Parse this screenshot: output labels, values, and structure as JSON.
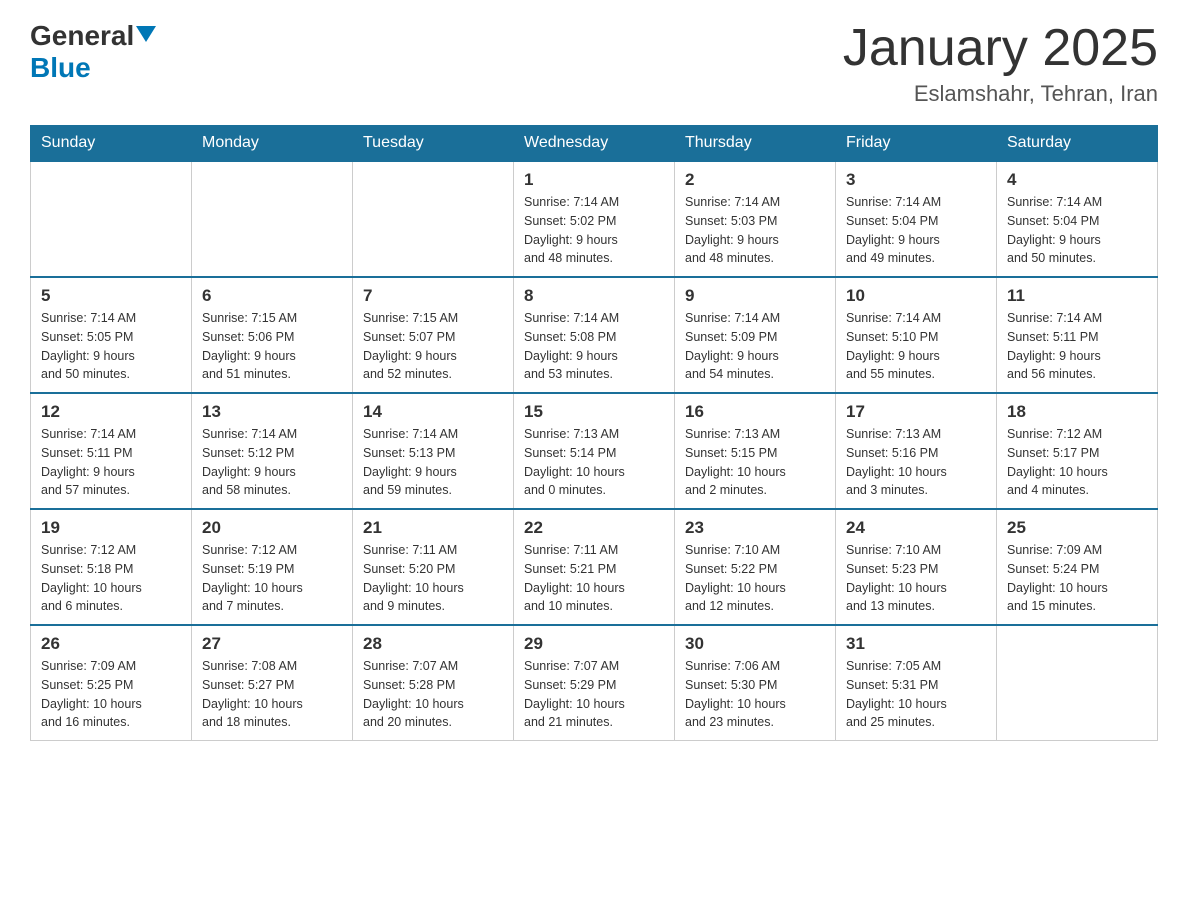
{
  "header": {
    "logo_general": "General",
    "logo_blue": "Blue",
    "month_title": "January 2025",
    "location": "Eslamshahr, Tehran, Iran"
  },
  "weekdays": [
    "Sunday",
    "Monday",
    "Tuesday",
    "Wednesday",
    "Thursday",
    "Friday",
    "Saturday"
  ],
  "weeks": [
    [
      {
        "day": "",
        "info": ""
      },
      {
        "day": "",
        "info": ""
      },
      {
        "day": "",
        "info": ""
      },
      {
        "day": "1",
        "info": "Sunrise: 7:14 AM\nSunset: 5:02 PM\nDaylight: 9 hours\nand 48 minutes."
      },
      {
        "day": "2",
        "info": "Sunrise: 7:14 AM\nSunset: 5:03 PM\nDaylight: 9 hours\nand 48 minutes."
      },
      {
        "day": "3",
        "info": "Sunrise: 7:14 AM\nSunset: 5:04 PM\nDaylight: 9 hours\nand 49 minutes."
      },
      {
        "day": "4",
        "info": "Sunrise: 7:14 AM\nSunset: 5:04 PM\nDaylight: 9 hours\nand 50 minutes."
      }
    ],
    [
      {
        "day": "5",
        "info": "Sunrise: 7:14 AM\nSunset: 5:05 PM\nDaylight: 9 hours\nand 50 minutes."
      },
      {
        "day": "6",
        "info": "Sunrise: 7:15 AM\nSunset: 5:06 PM\nDaylight: 9 hours\nand 51 minutes."
      },
      {
        "day": "7",
        "info": "Sunrise: 7:15 AM\nSunset: 5:07 PM\nDaylight: 9 hours\nand 52 minutes."
      },
      {
        "day": "8",
        "info": "Sunrise: 7:14 AM\nSunset: 5:08 PM\nDaylight: 9 hours\nand 53 minutes."
      },
      {
        "day": "9",
        "info": "Sunrise: 7:14 AM\nSunset: 5:09 PM\nDaylight: 9 hours\nand 54 minutes."
      },
      {
        "day": "10",
        "info": "Sunrise: 7:14 AM\nSunset: 5:10 PM\nDaylight: 9 hours\nand 55 minutes."
      },
      {
        "day": "11",
        "info": "Sunrise: 7:14 AM\nSunset: 5:11 PM\nDaylight: 9 hours\nand 56 minutes."
      }
    ],
    [
      {
        "day": "12",
        "info": "Sunrise: 7:14 AM\nSunset: 5:11 PM\nDaylight: 9 hours\nand 57 minutes."
      },
      {
        "day": "13",
        "info": "Sunrise: 7:14 AM\nSunset: 5:12 PM\nDaylight: 9 hours\nand 58 minutes."
      },
      {
        "day": "14",
        "info": "Sunrise: 7:14 AM\nSunset: 5:13 PM\nDaylight: 9 hours\nand 59 minutes."
      },
      {
        "day": "15",
        "info": "Sunrise: 7:13 AM\nSunset: 5:14 PM\nDaylight: 10 hours\nand 0 minutes."
      },
      {
        "day": "16",
        "info": "Sunrise: 7:13 AM\nSunset: 5:15 PM\nDaylight: 10 hours\nand 2 minutes."
      },
      {
        "day": "17",
        "info": "Sunrise: 7:13 AM\nSunset: 5:16 PM\nDaylight: 10 hours\nand 3 minutes."
      },
      {
        "day": "18",
        "info": "Sunrise: 7:12 AM\nSunset: 5:17 PM\nDaylight: 10 hours\nand 4 minutes."
      }
    ],
    [
      {
        "day": "19",
        "info": "Sunrise: 7:12 AM\nSunset: 5:18 PM\nDaylight: 10 hours\nand 6 minutes."
      },
      {
        "day": "20",
        "info": "Sunrise: 7:12 AM\nSunset: 5:19 PM\nDaylight: 10 hours\nand 7 minutes."
      },
      {
        "day": "21",
        "info": "Sunrise: 7:11 AM\nSunset: 5:20 PM\nDaylight: 10 hours\nand 9 minutes."
      },
      {
        "day": "22",
        "info": "Sunrise: 7:11 AM\nSunset: 5:21 PM\nDaylight: 10 hours\nand 10 minutes."
      },
      {
        "day": "23",
        "info": "Sunrise: 7:10 AM\nSunset: 5:22 PM\nDaylight: 10 hours\nand 12 minutes."
      },
      {
        "day": "24",
        "info": "Sunrise: 7:10 AM\nSunset: 5:23 PM\nDaylight: 10 hours\nand 13 minutes."
      },
      {
        "day": "25",
        "info": "Sunrise: 7:09 AM\nSunset: 5:24 PM\nDaylight: 10 hours\nand 15 minutes."
      }
    ],
    [
      {
        "day": "26",
        "info": "Sunrise: 7:09 AM\nSunset: 5:25 PM\nDaylight: 10 hours\nand 16 minutes."
      },
      {
        "day": "27",
        "info": "Sunrise: 7:08 AM\nSunset: 5:27 PM\nDaylight: 10 hours\nand 18 minutes."
      },
      {
        "day": "28",
        "info": "Sunrise: 7:07 AM\nSunset: 5:28 PM\nDaylight: 10 hours\nand 20 minutes."
      },
      {
        "day": "29",
        "info": "Sunrise: 7:07 AM\nSunset: 5:29 PM\nDaylight: 10 hours\nand 21 minutes."
      },
      {
        "day": "30",
        "info": "Sunrise: 7:06 AM\nSunset: 5:30 PM\nDaylight: 10 hours\nand 23 minutes."
      },
      {
        "day": "31",
        "info": "Sunrise: 7:05 AM\nSunset: 5:31 PM\nDaylight: 10 hours\nand 25 minutes."
      },
      {
        "day": "",
        "info": ""
      }
    ]
  ]
}
